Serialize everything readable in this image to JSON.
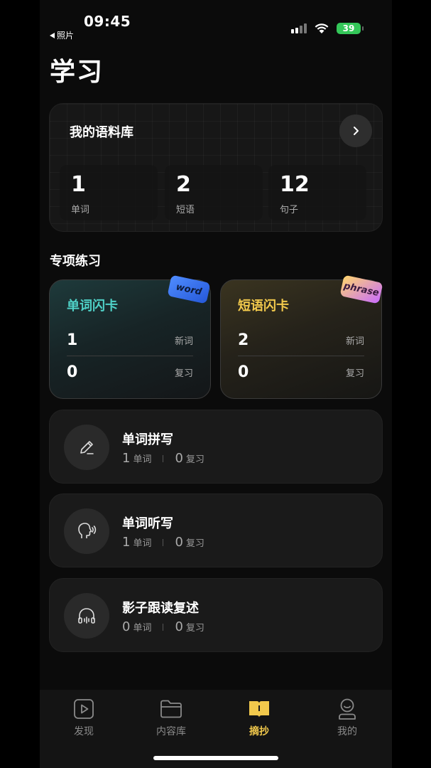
{
  "status": {
    "time": "09:45",
    "back_label": "照片",
    "battery": "39"
  },
  "page_title": "学习",
  "corpus": {
    "title": "我的语料库",
    "stats": [
      {
        "value": "1",
        "label": "单词"
      },
      {
        "value": "2",
        "label": "短语"
      },
      {
        "value": "12",
        "label": "句子"
      }
    ]
  },
  "section_title": "专项练习",
  "flashcards": {
    "word": {
      "title": "单词闪卡",
      "badge": "word",
      "new_count": "1",
      "new_label": "新词",
      "review_count": "0",
      "review_label": "复习"
    },
    "phrase": {
      "title": "短语闪卡",
      "badge": "phrase",
      "new_count": "2",
      "new_label": "新词",
      "review_count": "0",
      "review_label": "复习"
    }
  },
  "practice": [
    {
      "title": "单词拼写",
      "count": "1",
      "count_label": "单词",
      "review": "0",
      "review_label": "复习",
      "icon": "pencil-icon"
    },
    {
      "title": "单词听写",
      "count": "1",
      "count_label": "单词",
      "review": "0",
      "review_label": "复习",
      "icon": "speaking-head-icon"
    },
    {
      "title": "影子跟读复述",
      "count": "0",
      "count_label": "单词",
      "review": "0",
      "review_label": "复习",
      "icon": "headphones-icon"
    }
  ],
  "tabs": [
    {
      "label": "发现",
      "icon": "play-icon",
      "active": false
    },
    {
      "label": "内容库",
      "icon": "folder-icon",
      "active": false
    },
    {
      "label": "摘抄",
      "icon": "book-icon",
      "active": true
    },
    {
      "label": "我的",
      "icon": "profile-icon",
      "active": false
    }
  ],
  "colors": {
    "accent_yellow": "#f2c94c",
    "accent_teal": "#4fd1c7",
    "battery_green": "#34c759"
  }
}
